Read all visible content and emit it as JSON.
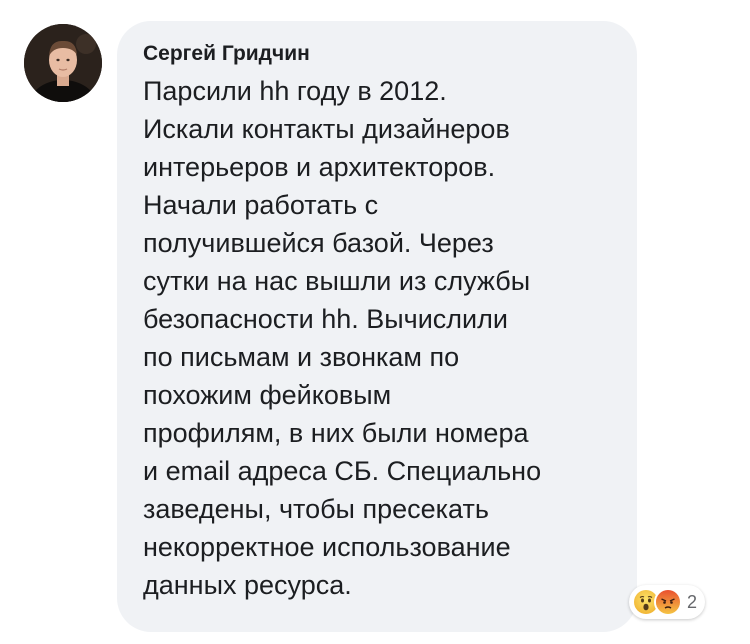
{
  "comment": {
    "author": "Сергей Гридчин",
    "text": "Парсили hh году в 2012.\nИскали контакты дизайнеров\nинтерьеров и архитекторов.\nНачали работать с\nполучившейся базой. Через\nсутки на нас вышли из службы\nбезопасности hh. Вычислили\nпо письмам и звонкам по\nпохожим фейковым\nпрофилям, в них были номера\nи email адреса СБ. Специально\nзаведены, чтобы пресекать\nнекорректное использование\nданных ресурса.",
    "avatar_icon": "user-avatar-photo",
    "bubble_color": "#f0f2f5"
  },
  "reactions": {
    "icons": [
      "wow-reaction-icon",
      "angry-reaction-icon"
    ],
    "count": "2"
  }
}
